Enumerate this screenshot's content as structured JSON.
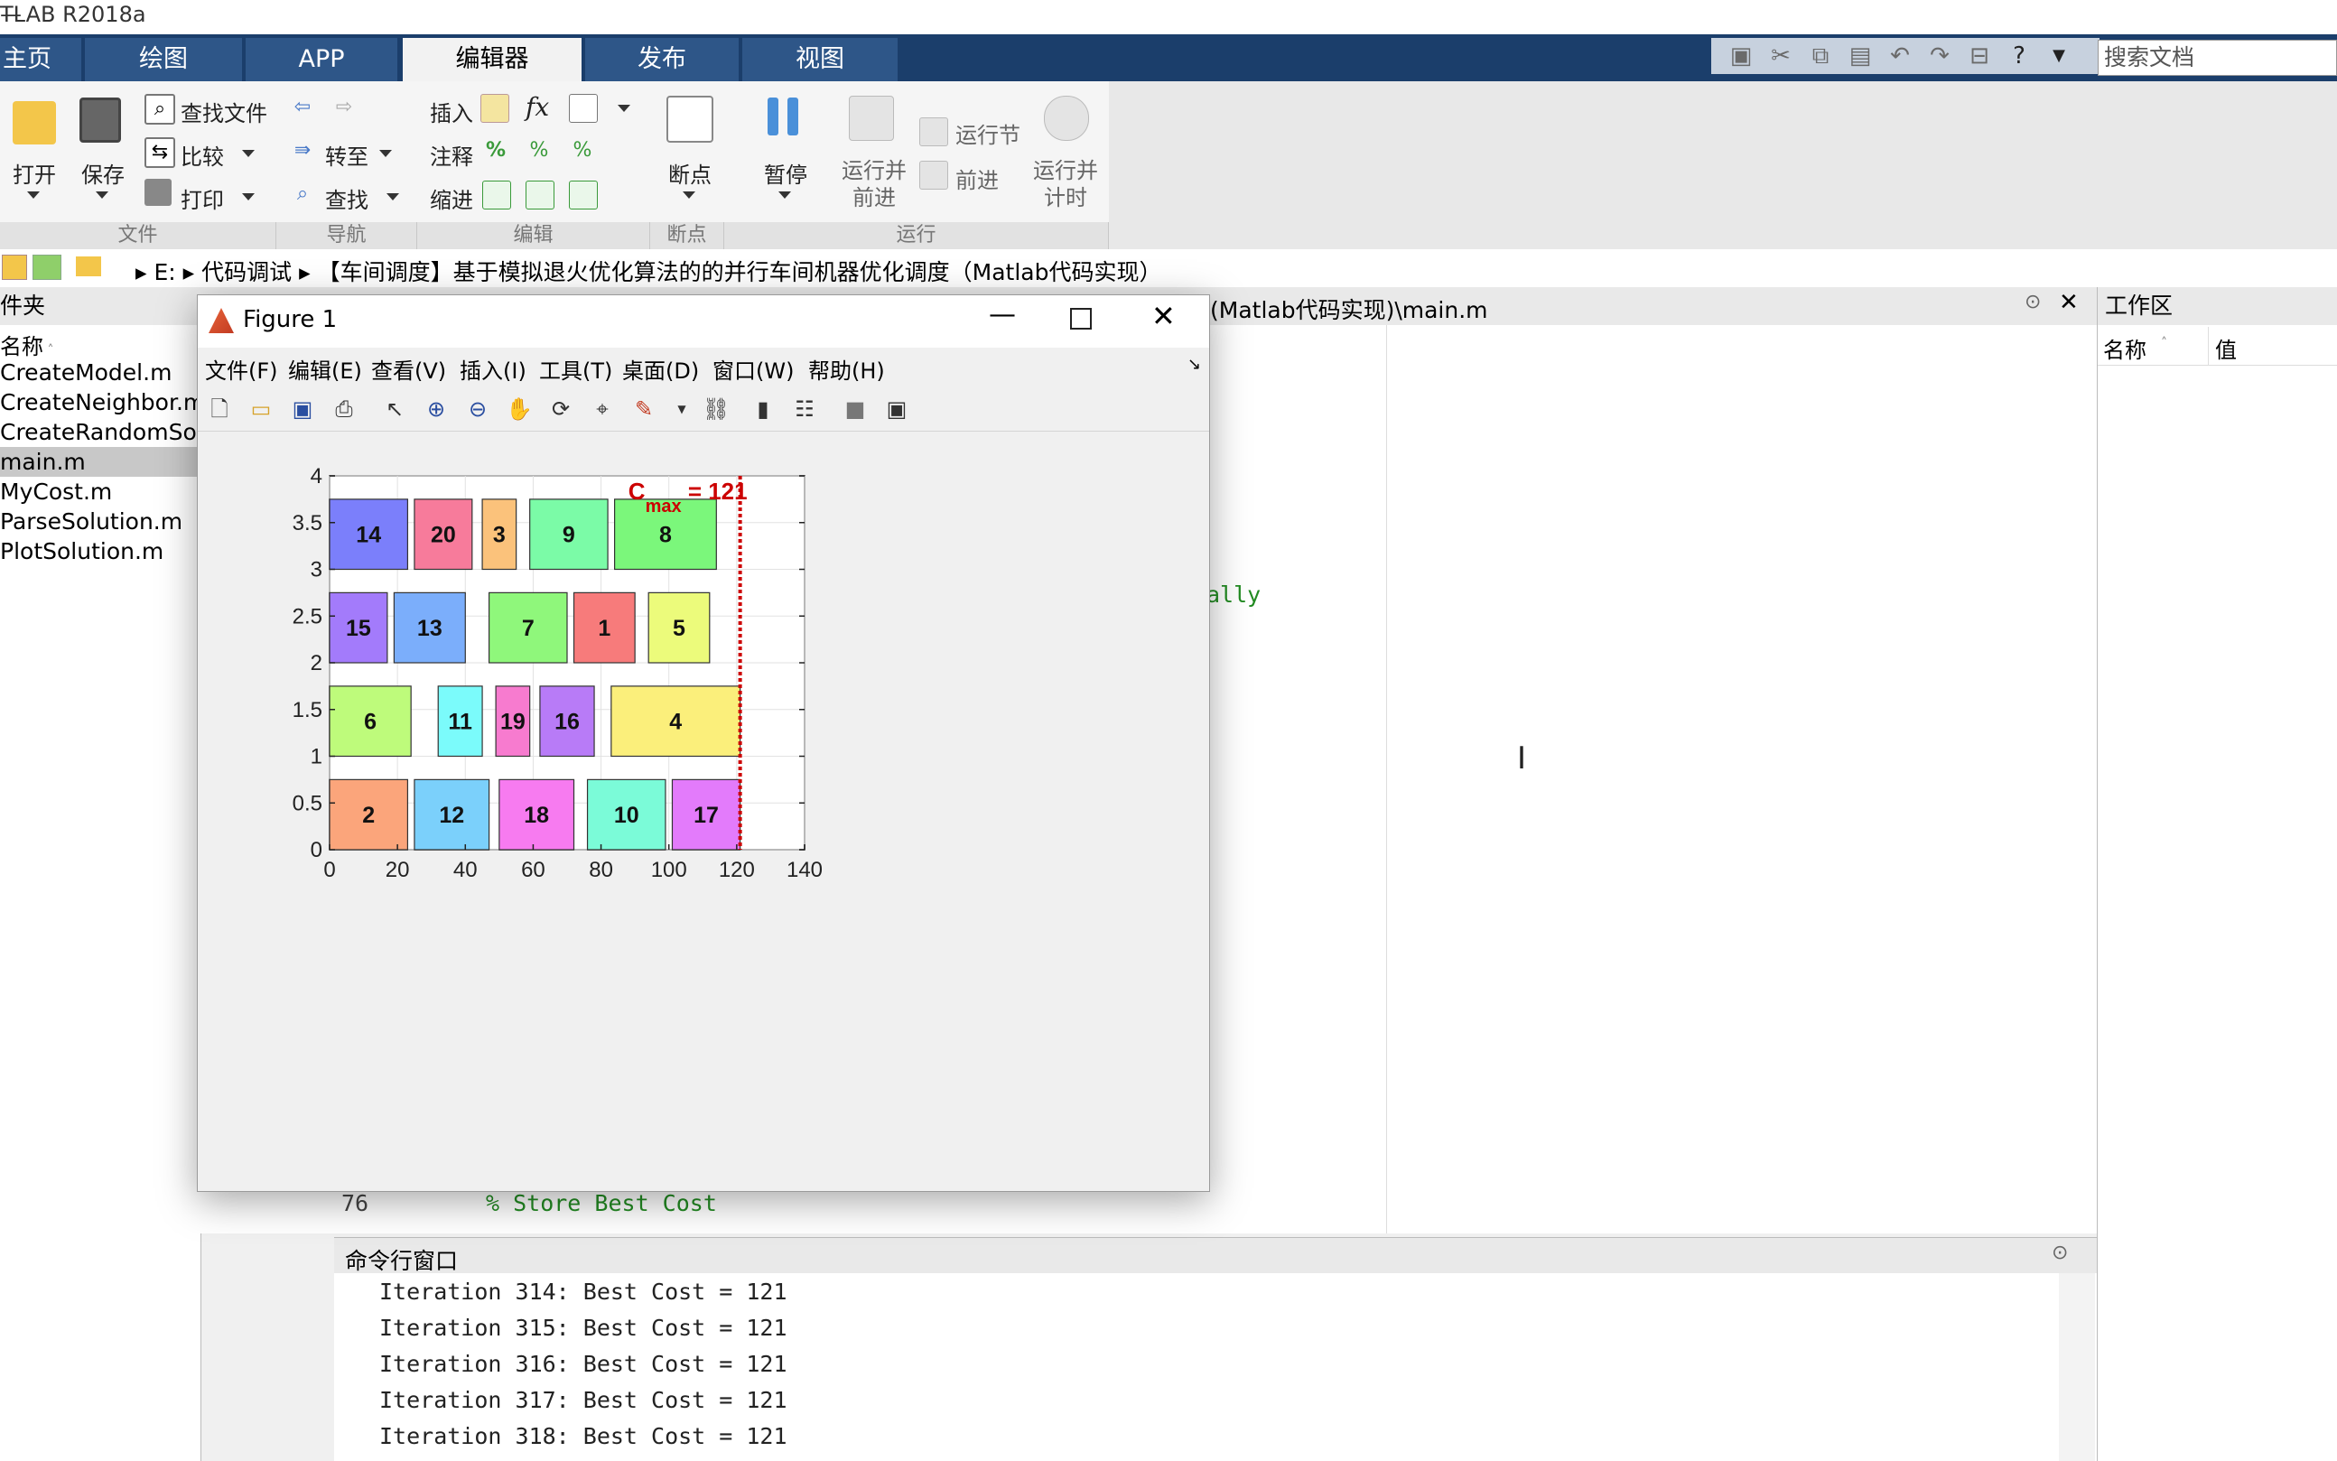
{
  "window": {
    "title": "TLAB R2018a",
    "minimize_glyph": "—"
  },
  "tabs": [
    {
      "label": "主页"
    },
    {
      "label": "绘图"
    },
    {
      "label": "APP"
    },
    {
      "label": "编辑器"
    },
    {
      "label": "发布"
    },
    {
      "label": "视图"
    }
  ],
  "search": {
    "placeholder": "搜索文档"
  },
  "ribbon": {
    "file": {
      "open": "打开",
      "save": "保存",
      "find_files": "查找文件",
      "compare": "比较",
      "print": "打印",
      "group": "文件"
    },
    "nav": {
      "goto": "转至",
      "find": "查找",
      "group": "导航"
    },
    "edit": {
      "insert": "插入",
      "comment": "注释",
      "indent": "缩进",
      "fx": "fx",
      "group": "编辑"
    },
    "breakpoints": {
      "label": "断点",
      "group": "断点"
    },
    "run": {
      "pause": "暂停",
      "run_advance": "运行并\n前进",
      "run_section": "运行节",
      "advance": "前进",
      "run_time": "运行并\n计时",
      "group": "运行"
    }
  },
  "address": {
    "drive": "E:",
    "folder1": "代码调试",
    "folder2": "【车间调度】基于模拟退火优化算法的的并行车间机器优化调度（Matlab代码实现）"
  },
  "left_panel": {
    "header": "件夹",
    "column": "名称",
    "files": [
      "CreateModel.m",
      "CreateNeighbor.m",
      "CreateRandomSolu",
      "main.m",
      "MyCost.m",
      "ParseSolution.m",
      "PlotSolution.m"
    ]
  },
  "editor": {
    "tab_path": "(Matlab代码实现)\\main.m",
    "visible_fragment": "ally",
    "line_number": "76",
    "line_code": "% Store Best Cost"
  },
  "workspace": {
    "header": "工作区",
    "col_name": "名称",
    "col_value": "值"
  },
  "command_window": {
    "header": "命令行窗口",
    "lines": [
      "Iteration 314: Best Cost = 121",
      "Iteration 315: Best Cost = 121",
      "Iteration 316: Best Cost = 121",
      "Iteration 317: Best Cost = 121",
      "Iteration 318: Best Cost = 121"
    ]
  },
  "figure": {
    "title": "Figure 1",
    "menu": [
      "文件(F)",
      "编辑(E)",
      "查看(V)",
      "插入(I)",
      "工具(T)",
      "桌面(D)",
      "窗口(W)",
      "帮助(H)"
    ]
  },
  "chart_data": {
    "type": "gantt",
    "xlim": [
      0,
      140
    ],
    "ylim": [
      0,
      4
    ],
    "xticks": [
      "0",
      "20",
      "40",
      "60",
      "80",
      "100",
      "120",
      "140"
    ],
    "yticks": [
      "0",
      "0.5",
      "1",
      "1.5",
      "2",
      "2.5",
      "3",
      "3.5",
      "4"
    ],
    "grid": true,
    "cmax_value": 121,
    "cmax_label_c": "C",
    "cmax_label_sub": "max",
    "cmax_label_rest": " = 121",
    "cmax_color": "#cc0000",
    "jobs": [
      {
        "job": "14",
        "start": 0,
        "end": 23,
        "ylow": 3.0,
        "yhigh": 3.75,
        "color": "#7b7ffb"
      },
      {
        "job": "20",
        "start": 25,
        "end": 42,
        "ylow": 3.0,
        "yhigh": 3.75,
        "color": "#f77b9b"
      },
      {
        "job": "3",
        "start": 45,
        "end": 55,
        "ylow": 3.0,
        "yhigh": 3.75,
        "color": "#fbc27b"
      },
      {
        "job": "9",
        "start": 59,
        "end": 82,
        "ylow": 3.0,
        "yhigh": 3.75,
        "color": "#7bfba7"
      },
      {
        "job": "8",
        "start": 84,
        "end": 114,
        "ylow": 3.0,
        "yhigh": 3.75,
        "color": "#7bf77b"
      },
      {
        "job": "15",
        "start": 0,
        "end": 17,
        "ylow": 2.0,
        "yhigh": 2.75,
        "color": "#a37bfb"
      },
      {
        "job": "13",
        "start": 19,
        "end": 40,
        "ylow": 2.0,
        "yhigh": 2.75,
        "color": "#7baefb"
      },
      {
        "job": "7",
        "start": 47,
        "end": 70,
        "ylow": 2.0,
        "yhigh": 2.75,
        "color": "#8ff77b"
      },
      {
        "job": "1",
        "start": 72,
        "end": 90,
        "ylow": 2.0,
        "yhigh": 2.75,
        "color": "#f77b7b"
      },
      {
        "job": "5",
        "start": 94,
        "end": 112,
        "ylow": 2.0,
        "yhigh": 2.75,
        "color": "#ecfb7b"
      },
      {
        "job": "6",
        "start": 0,
        "end": 24,
        "ylow": 1.0,
        "yhigh": 1.75,
        "color": "#befb7b"
      },
      {
        "job": "11",
        "start": 32,
        "end": 45,
        "ylow": 1.0,
        "yhigh": 1.75,
        "color": "#7bfbfb"
      },
      {
        "job": "19",
        "start": 49,
        "end": 59,
        "ylow": 1.0,
        "yhigh": 1.75,
        "color": "#f77bcf"
      },
      {
        "job": "16",
        "start": 62,
        "end": 78,
        "ylow": 1.0,
        "yhigh": 1.75,
        "color": "#b87bf7"
      },
      {
        "job": "4",
        "start": 83,
        "end": 121,
        "ylow": 1.0,
        "yhigh": 1.75,
        "color": "#fbef7b"
      },
      {
        "job": "2",
        "start": 0,
        "end": 23,
        "ylow": 0.0,
        "yhigh": 0.75,
        "color": "#fba57b"
      },
      {
        "job": "12",
        "start": 25,
        "end": 47,
        "ylow": 0.0,
        "yhigh": 0.75,
        "color": "#7bd0fb"
      },
      {
        "job": "18",
        "start": 50,
        "end": 72,
        "ylow": 0.0,
        "yhigh": 0.75,
        "color": "#f77bf0"
      },
      {
        "job": "10",
        "start": 76,
        "end": 99,
        "ylow": 0.0,
        "yhigh": 0.75,
        "color": "#7bfbd8"
      },
      {
        "job": "17",
        "start": 101,
        "end": 121,
        "ylow": 0.0,
        "yhigh": 0.75,
        "color": "#e37bfb"
      }
    ]
  }
}
